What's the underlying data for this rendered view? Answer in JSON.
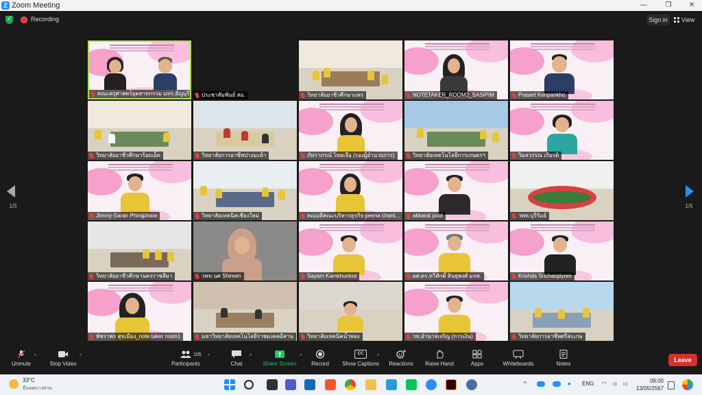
{
  "window": {
    "title": "Zoom Meeting",
    "app_icon_letter": "Z"
  },
  "topbar": {
    "recording_label": "Recording",
    "sign_in_label": "Sign in",
    "view_label": "View"
  },
  "pagination": {
    "left": "1/5",
    "right": "1/5"
  },
  "participants": [
    "คณะครุศาสตร์อุตสาหกรรม มทร.ธัญบุรี",
    "ประชาสัมพันธ์ สอ.",
    "วิทยาลัยอาชีวศึกษาแพร่",
    "NOTETAKER_ROOM2_SASIPIM",
    "Prasert Kenpankho",
    "วิทยาลัยอาชีวศึกษาร้อยเอ็ด",
    "วิทยาลัยการอาชีพปางมะผ้า",
    "ภัทราภรณ์ ไทยเจือ (รองผู้อำนวยการ)",
    "วิทยาลัยเทคโนโลยีการเกษตรฯ",
    "วิมลวรรณ เกียรติ",
    "Jimmy-Saran Phinijphara",
    "วิทยาลัยเทคนิคเชียงใหม่",
    "คณบดีคณะบริหารธุรกิจ peena chant...",
    "akkarat pool",
    "วพท.บุรีรัมย์",
    "วิทยาลัยอาชีวศึกษานครราชสีมา",
    "วพท.นศ Shireen",
    "Sayam Kamkhuntod",
    "ผศ.ดร.ทวีศักดิ์ สินธุพงศ์ มจพ.",
    "Krishda Srichanpiyom",
    "พัชราพร สุขเมือง_note taker room1",
    "มหาวิทยาลัยเทคโนโลยีราชมงคลอีสาน",
    "วิทยาลัยเทคนิคน้ำพอง",
    "วท.อำนาจเจริญ (การเงิน)",
    "วิทยาลัยการอาชีพศรีสะเกษ"
  ],
  "toolbar": {
    "unmute": "Unmute",
    "stop_video": "Stop Video",
    "participants": "Participants",
    "participants_count": "105",
    "chat": "Chat",
    "share_screen": "Share Screen",
    "record": "Record",
    "show_captions": "Show Captions",
    "cc_badge": "CC",
    "reactions": "Reactions",
    "raise_hand": "Raise Hand",
    "apps": "Apps",
    "whiteboards": "Whiteboards",
    "notes": "Notes",
    "leave": "Leave"
  },
  "taskbar": {
    "temperature": "33°C",
    "weather_desc": "มีแดดบางส่วน",
    "language": "ENG",
    "time": "09:00",
    "date": "13/05/2567"
  },
  "colors": {
    "accent": "#2d8cff",
    "active_speaker": "#a7e04a",
    "leave": "#d92e2e",
    "share": "#22c55e"
  }
}
